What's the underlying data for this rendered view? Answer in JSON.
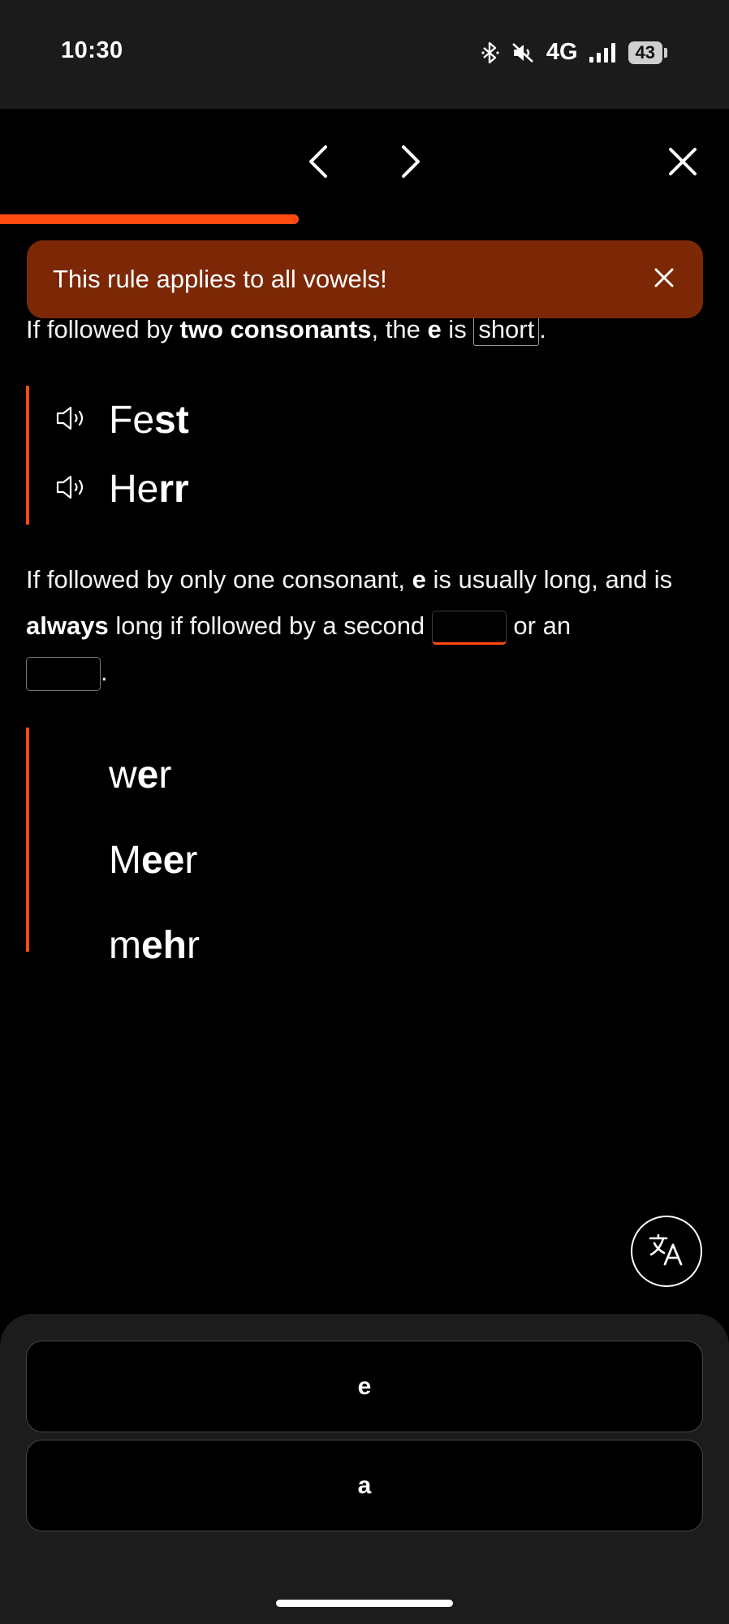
{
  "status_bar": {
    "time": "10:30",
    "network": "4G",
    "battery": "43",
    "icons": [
      "bluetooth-icon",
      "mute-icon",
      "signal-icon",
      "battery-icon"
    ]
  },
  "nav": {
    "icons": [
      "chevron-left-icon",
      "chevron-right-icon",
      "close-icon"
    ]
  },
  "progress": {
    "fraction": 0.41,
    "color": "#ff4b12"
  },
  "toast": {
    "text": "This rule applies to all vowels!",
    "background": "#7c2806"
  },
  "lesson": {
    "rule1": {
      "t1": "If followed by ",
      "b1": "two consonants",
      "t2": ", the ",
      "b2": "e",
      "t3": " is ",
      "answer": "short",
      "t4": "."
    },
    "examples1": [
      {
        "pre": "Fe",
        "bold": "st",
        "post": ""
      },
      {
        "pre": "He",
        "bold": "rr",
        "post": ""
      }
    ],
    "rule2": {
      "t1": "If followed by only one consonant, ",
      "b1": "e",
      "t2": " is usually long, and is ",
      "b2": "always",
      "t3": " long if followed by a second ",
      "t4": " or an ",
      "t5": "."
    },
    "examples2": [
      {
        "pre": "w",
        "bold": "e",
        "post": "r"
      },
      {
        "pre": "M",
        "bold": "ee",
        "post": "r"
      },
      {
        "pre": "m",
        "bold": "eh",
        "post": "r"
      }
    ]
  },
  "translate_icon": "translate-icon",
  "choices": [
    "e",
    "a"
  ],
  "accent_color": "#ff4b12"
}
